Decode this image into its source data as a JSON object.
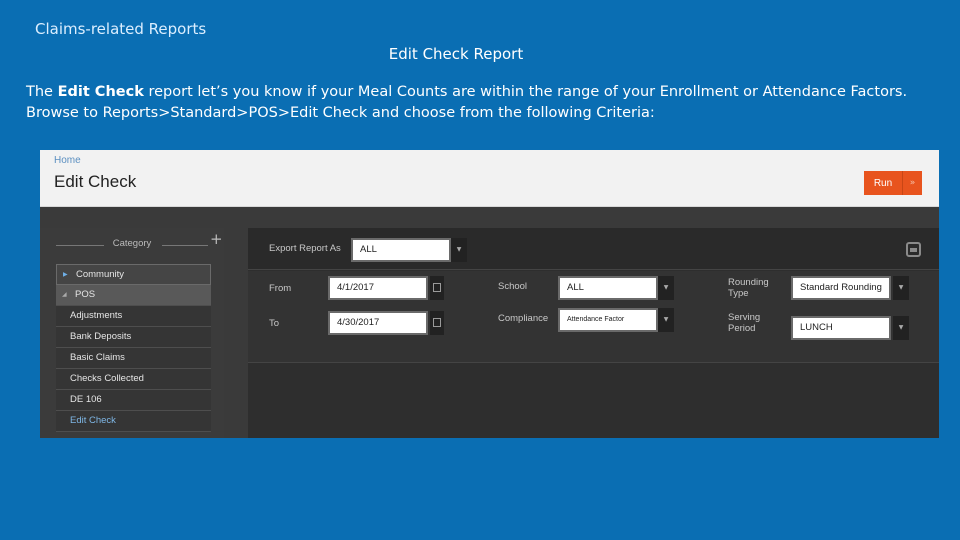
{
  "slide": {
    "header": "Claims-related Reports",
    "title": "Edit Check Report",
    "intro_prefix": "The ",
    "intro_bold": "Edit Check",
    "intro_rest": " report let’s you know if your Meal Counts are within the range of your Enrollment or Attendance Factors. Browse to Reports>Standard>POS>Edit Check and choose from the following Criteria:"
  },
  "app": {
    "breadcrumb": "Home",
    "page_title": "Edit Check",
    "run_label": "Run",
    "run_extra": "»",
    "sidebar": {
      "add_glyph": "+",
      "category_label": "Category",
      "items": [
        {
          "label": "Community"
        },
        {
          "label": "POS"
        },
        {
          "label": "Adjustments"
        },
        {
          "label": "Bank Deposits"
        },
        {
          "label": "Basic Claims"
        },
        {
          "label": "Checks Collected"
        },
        {
          "label": "DE 106"
        },
        {
          "label": "Edit Check"
        }
      ]
    },
    "criteria": {
      "export_label": "Export Report As",
      "export_value": "ALL",
      "from_label": "From",
      "from_value": "4/1/2017",
      "to_label": "To",
      "to_value": "4/30/2017",
      "school_label": "School",
      "school_value": "ALL",
      "compliance_label": "Compliance",
      "compliance_value": "Attendance Factor",
      "rounding_label_1": "Rounding",
      "rounding_label_2": "Type",
      "rounding_value": "Standard Rounding",
      "serving_label_1": "Serving",
      "serving_label_2": "Period",
      "serving_value": "LUNCH",
      "dropdown_glyph": "▼"
    }
  },
  "colors": {
    "slide_background": "#0a6eb3",
    "run_button": "#e8541e",
    "selected_item": "#7fb7e6"
  }
}
